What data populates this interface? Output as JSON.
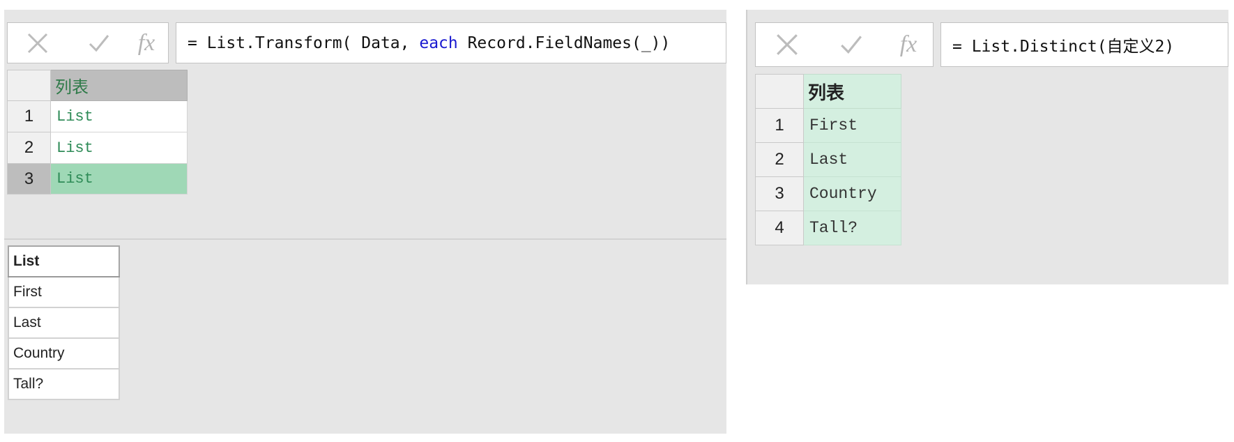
{
  "left": {
    "toolbar": {
      "cancel_icon": "close-icon",
      "confirm_icon": "check-icon",
      "fx_label": "fx"
    },
    "formula": {
      "prefix": "= List.Transform( Data, ",
      "keyword": "each",
      "suffix": " Record.FieldNames(_))"
    },
    "grid": {
      "header": "列表",
      "rows": [
        {
          "num": "1",
          "value": "List"
        },
        {
          "num": "2",
          "value": "List"
        },
        {
          "num": "3",
          "value": "List"
        }
      ]
    },
    "result": {
      "header": "List",
      "rows": [
        "First",
        "Last",
        "Country",
        "Tall?"
      ]
    }
  },
  "right": {
    "toolbar": {
      "cancel_icon": "close-icon",
      "confirm_icon": "check-icon",
      "fx_label": "fx"
    },
    "formula": "= List.Distinct(自定义2)",
    "grid": {
      "header": "列表",
      "rows": [
        {
          "num": "1",
          "value": "First"
        },
        {
          "num": "2",
          "value": "Last"
        },
        {
          "num": "3",
          "value": "Country"
        },
        {
          "num": "4",
          "value": "Tall?"
        }
      ]
    }
  },
  "colors": {
    "selected_row": "#9fd8b6",
    "keyword": "#1a1ad0",
    "cell_text": "#2e8b57",
    "header_green_bg": "#d4efe0"
  }
}
